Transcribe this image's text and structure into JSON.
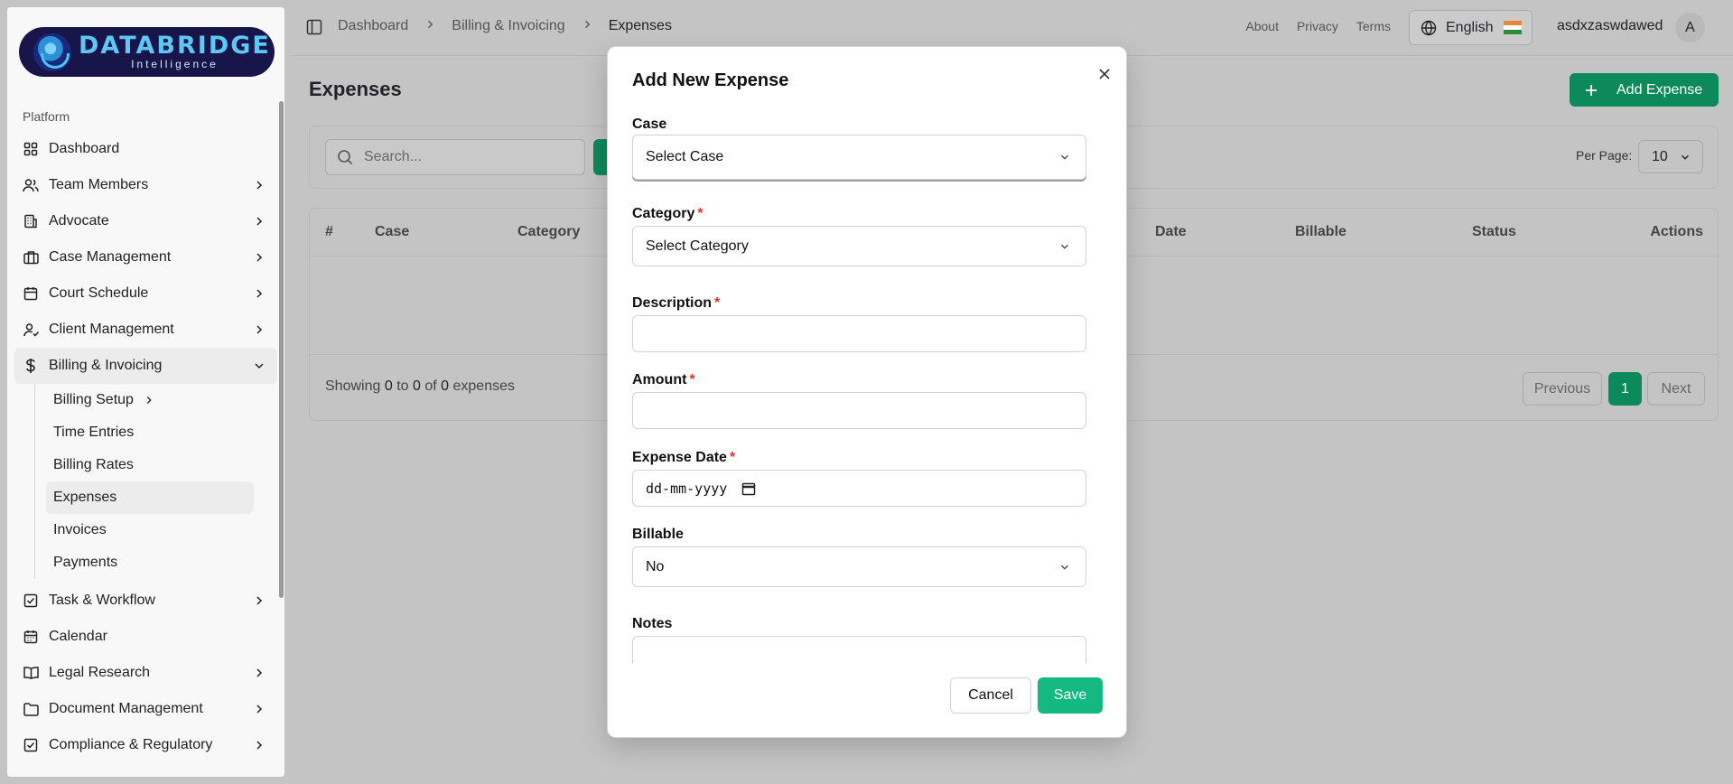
{
  "brand": {
    "name": "DATABRIDGE",
    "tagline": "Intelligence"
  },
  "sidebar": {
    "section_label": "Platform",
    "items": [
      {
        "label": "Dashboard",
        "icon": "grid-icon",
        "has_children": false
      },
      {
        "label": "Team Members",
        "icon": "users-icon",
        "has_children": true
      },
      {
        "label": "Advocate",
        "icon": "building-icon",
        "has_children": true
      },
      {
        "label": "Case Management",
        "icon": "briefcase-icon",
        "has_children": true
      },
      {
        "label": "Court Schedule",
        "icon": "calendar-icon",
        "has_children": true
      },
      {
        "label": "Client Management",
        "icon": "user-check-icon",
        "has_children": true
      },
      {
        "label": "Billing & Invoicing",
        "icon": "dollar-icon",
        "has_children": true,
        "expanded": true
      },
      {
        "label": "Task & Workflow",
        "icon": "checkbox-icon",
        "has_children": true
      },
      {
        "label": "Calendar",
        "icon": "calendar-icon",
        "has_children": false
      },
      {
        "label": "Legal Research",
        "icon": "book-icon",
        "has_children": true
      },
      {
        "label": "Document Management",
        "icon": "folder-icon",
        "has_children": true
      },
      {
        "label": "Compliance & Regulatory",
        "icon": "checkbox-icon",
        "has_children": true
      }
    ],
    "billing_sub": [
      {
        "label": "Billing Setup",
        "has_children": true
      },
      {
        "label": "Time Entries"
      },
      {
        "label": "Billing Rates"
      },
      {
        "label": "Expenses",
        "active": true
      },
      {
        "label": "Invoices"
      },
      {
        "label": "Payments"
      }
    ]
  },
  "header": {
    "breadcrumb": [
      "Dashboard",
      "Billing & Invoicing",
      "Expenses"
    ],
    "links": [
      "About",
      "Privacy",
      "Terms"
    ],
    "language": "English",
    "username": "asdxzaswdawed",
    "avatar_initial": "A"
  },
  "page": {
    "title": "Expenses",
    "add_button": "Add Expense",
    "search_placeholder": "Search...",
    "per_page_label": "Per Page:",
    "per_page_value": "10",
    "table_headers": [
      "#",
      "Case",
      "Category",
      "Date",
      "Billable",
      "Status",
      "Actions"
    ],
    "showing": {
      "prefix": "Showing",
      "from": "0",
      "to_word": "to",
      "to": "0",
      "of_word": "of",
      "total": "0",
      "suffix": "expenses"
    },
    "pagination": {
      "previous": "Previous",
      "current": "1",
      "next": "Next"
    }
  },
  "modal": {
    "title": "Add New Expense",
    "fields": {
      "case": {
        "label": "Case",
        "value": "Select Case",
        "required": false
      },
      "category": {
        "label": "Category",
        "value": "Select Category",
        "required": true
      },
      "description": {
        "label": "Description",
        "value": "",
        "required": true
      },
      "amount": {
        "label": "Amount",
        "value": "",
        "required": true
      },
      "expense_date": {
        "label": "Expense Date",
        "value": "dd-mm-yyyy",
        "required": true
      },
      "billable": {
        "label": "Billable",
        "value": "No",
        "required": false
      },
      "notes": {
        "label": "Notes",
        "value": "",
        "required": false
      }
    },
    "required_mark": "*",
    "cancel": "Cancel",
    "save": "Save"
  },
  "colors": {
    "primary": "#14b981",
    "primary_dim": "#0d8a5c",
    "required": "#e03131",
    "overlay": "#c4c4c4"
  }
}
